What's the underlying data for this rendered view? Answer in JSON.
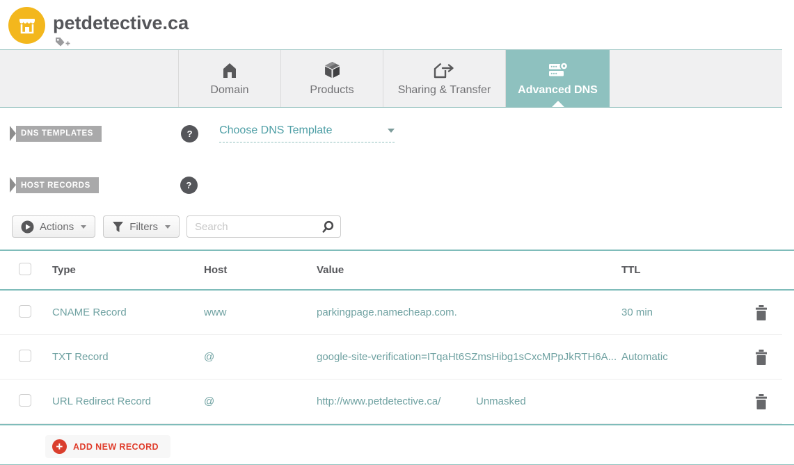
{
  "header": {
    "domain": "petdetective.ca"
  },
  "tabs": [
    {
      "label": "Domain",
      "icon": "home-icon",
      "active": false
    },
    {
      "label": "Products",
      "icon": "package-icon",
      "active": false
    },
    {
      "label": "Sharing & Transfer",
      "icon": "house-transfer-icon",
      "active": false
    },
    {
      "label": "Advanced DNS",
      "icon": "dns-server-gear-icon",
      "active": true
    }
  ],
  "sections": {
    "dns_templates": {
      "label": "DNS TEMPLATES",
      "help_icon": "?",
      "dropdown": {
        "selected": "Choose DNS Template"
      }
    },
    "host_records": {
      "label": "HOST RECORDS",
      "help_icon": "?"
    }
  },
  "toolbar": {
    "actions_label": "Actions",
    "filters_label": "Filters",
    "search_placeholder": "Search"
  },
  "table": {
    "columns": [
      "Type",
      "Host",
      "Value",
      "TTL"
    ],
    "rows": [
      {
        "type": "CNAME Record",
        "host": "www",
        "value": "parkingpage.namecheap.com.",
        "value_extra": "",
        "ttl": "30 min"
      },
      {
        "type": "TXT Record",
        "host": "@",
        "value": "google-site-verification=ITqaHt6SZmsHibg1sCxcMPpJkRTH6A...",
        "value_extra": "",
        "ttl": "Automatic"
      },
      {
        "type": "URL Redirect Record",
        "host": "@",
        "value": "http://www.petdetective.ca/",
        "value_extra": "Unmasked",
        "ttl": ""
      }
    ]
  },
  "buttons": {
    "add_new_record": "ADD NEW RECORD",
    "add_icon_glyph": "+"
  },
  "colors": {
    "brand_yellow": "#f3b71d",
    "accent_teal": "#8ec1bf",
    "teal_line": "#7fbcba",
    "link_teal": "#4f9fa6",
    "row_text_teal": "#70a2a2",
    "danger_red": "#da3e2d",
    "ribbon_gray": "#a9a9aa",
    "dark_gray": "#55565a"
  }
}
